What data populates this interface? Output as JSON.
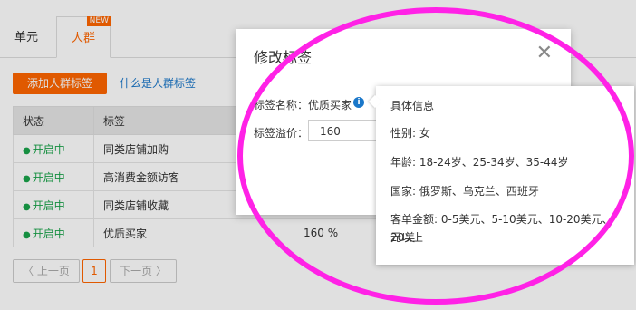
{
  "tabs": [
    {
      "label": "单元"
    },
    {
      "label": "人群",
      "badge": "NEW"
    }
  ],
  "toolbar": {
    "add_button": "添加人群标签",
    "help_link": "什么是人群标签"
  },
  "table": {
    "headers": [
      "状态",
      "标签",
      ""
    ],
    "rows": [
      {
        "status": "开启中",
        "tag": "同类店铺加购",
        "premium": ""
      },
      {
        "status": "开启中",
        "tag": "高消费金额访客",
        "premium": ""
      },
      {
        "status": "开启中",
        "tag": "同类店铺收藏",
        "premium": ""
      },
      {
        "status": "开启中",
        "tag": "优质买家",
        "premium": "160 %"
      }
    ]
  },
  "pagination": {
    "prev": "上一页",
    "current": "1",
    "next": "下一页"
  },
  "modal": {
    "title": "修改标签",
    "name_label": "标签名称：优质买家",
    "premium_label": "标签溢价：",
    "premium_value": "160"
  },
  "tooltip": {
    "heading": "具体信息",
    "gender": "性别: 女",
    "age": "年龄: 18-24岁、25-34岁、35-44岁",
    "country": "国家: 俄罗斯、乌克兰、西班牙",
    "order_amount_line1": "客单金额: 0-5美元、5-10美元、10-20美元、20美",
    "order_amount_line2": "元以上"
  },
  "colors": {
    "accent": "#ff6600",
    "status_on": "#1aa34a",
    "link": "#1a77c9",
    "highlight": "#ff22e6"
  }
}
